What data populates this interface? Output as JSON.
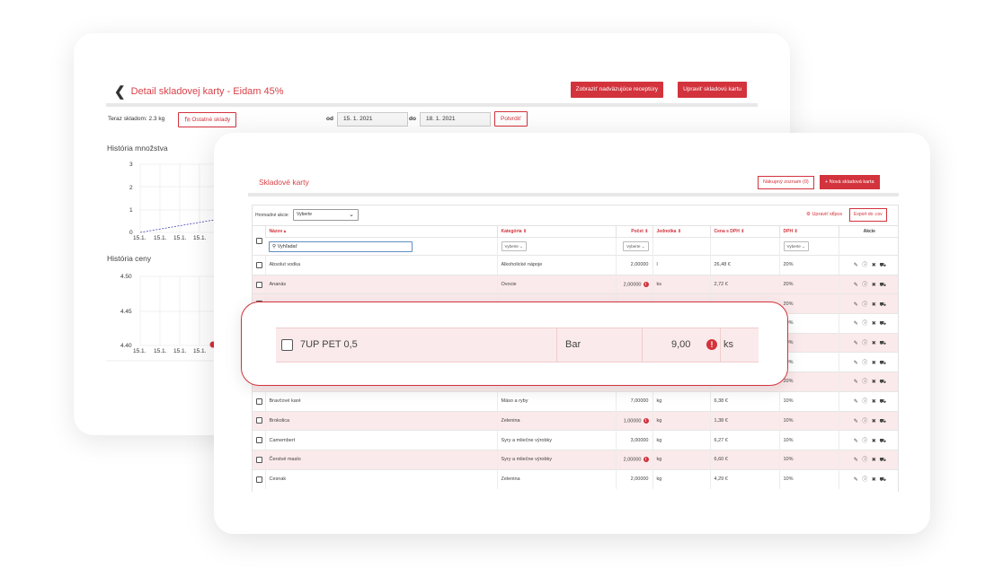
{
  "detail": {
    "title": "Detail skladovej karty - Eidam 45%",
    "btn_recipes": "Zobraziť nadväzujúce receptúry",
    "btn_edit": "Upraviť skladovú kartu",
    "stock_label": "Teraz skladom: 2.3 kg",
    "other_stocks": "Ostatné sklady",
    "from_label": "od",
    "from_date": "15. 1. 2021",
    "to_label": "do",
    "to_date": "18. 1. 2021",
    "confirm": "Potvrdiť"
  },
  "qty_chart": {
    "title": "História množstva",
    "y_ticks": [
      "3",
      "2",
      "1",
      "0"
    ],
    "x_ticks": [
      "15.1.",
      "15.1.",
      "15.1.",
      "15.1."
    ]
  },
  "price_chart": {
    "title": "História ceny",
    "y_ticks": [
      "4.50",
      "4.45",
      "4.40"
    ],
    "x_ticks": [
      "15.1.",
      "15.1.",
      "15.1.",
      "15.1."
    ]
  },
  "chart_data": [
    {
      "type": "line",
      "title": "História množstva",
      "y_ticks": [
        3,
        2,
        1,
        0
      ],
      "x": [
        "15.1.",
        "15.1.",
        "15.1.",
        "15.1."
      ],
      "ylim": [
        0,
        3
      ],
      "grid": true
    },
    {
      "type": "line",
      "title": "História ceny",
      "y_ticks": [
        4.5,
        4.45,
        4.4
      ],
      "x": [
        "15.1.",
        "15.1.",
        "15.1.",
        "15.1."
      ],
      "ylim": [
        4.4,
        4.5
      ],
      "grid": true
    }
  ],
  "cards": {
    "title": "Skladové karty",
    "btn_shopping": "Nákupný zoznam (0)",
    "btn_new": "+ Nová skladová karta",
    "filter_label": "Hromadné akcie:",
    "filter_value": "Vyberte",
    "edit_columns": "⚙ Upraviť stĺpce",
    "export": "Export do .csv",
    "headers": {
      "name": "Názov ▴",
      "category": "Kategória ⇕",
      "count": "Počet ⇕",
      "unit": "Jednotka ⇕",
      "price": "Cena s DPH ⇕",
      "vat": "DPH ⇕",
      "actions": "Akcie"
    },
    "search_placeholder": "Vyhľadať",
    "select_placeholder": "Vyberte",
    "rows": [
      {
        "name": "Absolut vodka",
        "category": "Alkoholické nápoje",
        "count": "2,00000",
        "unit": "l",
        "price": "26,48 €",
        "vat": "20%"
      },
      {
        "name": "Ananás",
        "category": "Ovocie",
        "count": "2,00000",
        "unit": "ks",
        "price": "2,72 €",
        "vat": "20%"
      },
      {
        "name": "",
        "category": "",
        "count": "",
        "unit": "",
        "price": "",
        "vat": "20%"
      },
      {
        "name": "",
        "category": "",
        "count": "",
        "unit": "",
        "price": "",
        "vat": "20%"
      },
      {
        "name": "",
        "category": "",
        "count": "",
        "unit": "",
        "price": "",
        "vat": "20%"
      },
      {
        "name": "",
        "category": "",
        "count": "",
        "unit": "",
        "price": "",
        "vat": "20%"
      },
      {
        "name": "",
        "category": "",
        "count": "",
        "unit": "",
        "price": "",
        "vat": "20%"
      },
      {
        "name": "Bravčové karé",
        "category": "Mäso a ryby",
        "count": "7,00000",
        "unit": "kg",
        "price": "6,38 €",
        "vat": "10%"
      },
      {
        "name": "Brokolica",
        "category": "Zelenina",
        "count": "1,00000",
        "unit": "kg",
        "price": "1,38 €",
        "vat": "10%"
      },
      {
        "name": "Camembert",
        "category": "Syry a mliečne výrobky",
        "count": "3,00000",
        "unit": "kg",
        "price": "6,27 €",
        "vat": "10%"
      },
      {
        "name": "Čerstvé maslo",
        "category": "Syry a mliečne výrobky",
        "count": "2,00000",
        "unit": "kg",
        "price": "6,60 €",
        "vat": "10%"
      },
      {
        "name": "Cesnak",
        "category": "Zelenina",
        "count": "2,00000",
        "unit": "kg",
        "price": "4,29 €",
        "vat": "10%"
      }
    ]
  },
  "callout": {
    "name": "7UP PET 0,5",
    "category": "Bar",
    "count": "9,00",
    "unit": "ks"
  }
}
